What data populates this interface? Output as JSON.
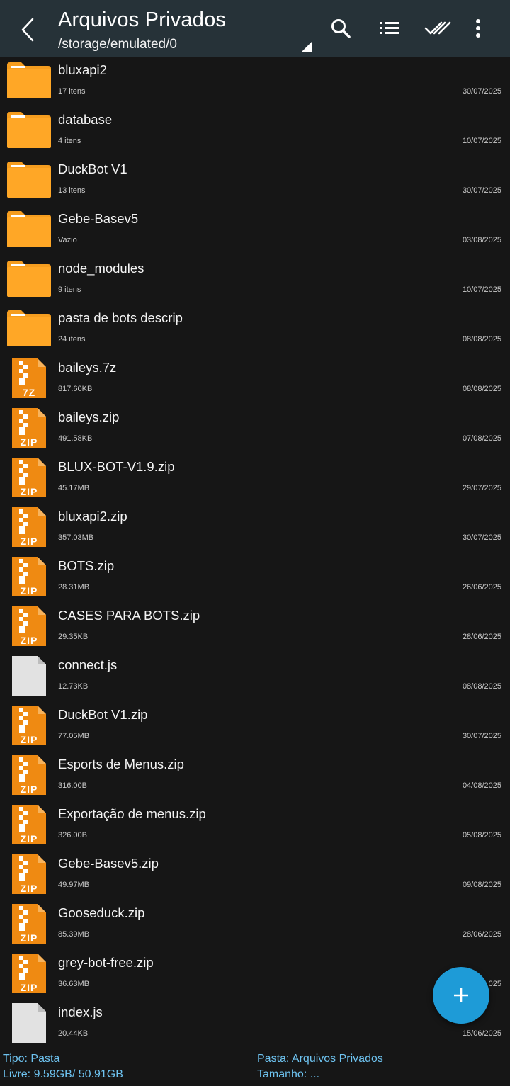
{
  "header": {
    "title": "Arquivos Privados",
    "path": "/storage/emulated/0"
  },
  "files": [
    {
      "name": "bluxapi2",
      "info": "17 itens",
      "date": "30/07/2025",
      "kind": "folder"
    },
    {
      "name": "database",
      "info": "4 itens",
      "date": "10/07/2025",
      "kind": "folder"
    },
    {
      "name": "DuckBot V1",
      "info": "13 itens",
      "date": "30/07/2025",
      "kind": "folder"
    },
    {
      "name": "Gebe-Basev5",
      "info": "Vazio",
      "date": "03/08/2025",
      "kind": "folder"
    },
    {
      "name": "node_modules",
      "info": "9 itens",
      "date": "10/07/2025",
      "kind": "folder"
    },
    {
      "name": "pasta de bots descrip",
      "info": "24 itens",
      "date": "08/08/2025",
      "kind": "folder"
    },
    {
      "name": "baileys.7z",
      "info": "817.60KB",
      "date": "08/08/2025",
      "kind": "archive",
      "label": "7Z"
    },
    {
      "name": "baileys.zip",
      "info": "491.58KB",
      "date": "07/08/2025",
      "kind": "archive",
      "label": "ZIP"
    },
    {
      "name": "BLUX-BOT-V1.9.zip",
      "info": "45.17MB",
      "date": "29/07/2025",
      "kind": "archive",
      "label": "ZIP"
    },
    {
      "name": "bluxapi2.zip",
      "info": "357.03MB",
      "date": "30/07/2025",
      "kind": "archive",
      "label": "ZIP"
    },
    {
      "name": "BOTS.zip",
      "info": "28.31MB",
      "date": "26/06/2025",
      "kind": "archive",
      "label": "ZIP"
    },
    {
      "name": "CASES PARA BOTS.zip",
      "info": "29.35KB",
      "date": "28/06/2025",
      "kind": "archive",
      "label": "ZIP"
    },
    {
      "name": "connect.js",
      "info": "12.73KB",
      "date": "08/08/2025",
      "kind": "document"
    },
    {
      "name": "DuckBot V1.zip",
      "info": "77.05MB",
      "date": "30/07/2025",
      "kind": "archive",
      "label": "ZIP"
    },
    {
      "name": "Esports de Menus.zip",
      "info": "316.00B",
      "date": "04/08/2025",
      "kind": "archive",
      "label": "ZIP"
    },
    {
      "name": "Exportação de menus.zip",
      "info": "326.00B",
      "date": "05/08/2025",
      "kind": "archive",
      "label": "ZIP"
    },
    {
      "name": "Gebe-Basev5.zip",
      "info": "49.97MB",
      "date": "09/08/2025",
      "kind": "archive",
      "label": "ZIP"
    },
    {
      "name": "Gooseduck.zip",
      "info": "85.39MB",
      "date": "28/06/2025",
      "kind": "archive",
      "label": "ZIP"
    },
    {
      "name": "grey-bot-free.zip",
      "info": "36.63MB",
      "date": "025",
      "kind": "archive",
      "label": "ZIP"
    },
    {
      "name": "index.js",
      "info": "20.44KB",
      "date": "15/06/2025",
      "kind": "document"
    }
  ],
  "footer": {
    "tipo": "Tipo: Pasta",
    "livre": "Livre: 9.59GB/ 50.91GB",
    "pasta": "Pasta: Arquivos Privados",
    "tamanho": "Tamanho: ..."
  },
  "colors": {
    "header_bg": "#263238",
    "folder": "#ffa726",
    "archive": "#ef8a12",
    "accent": "#1e9bd7",
    "footer_text": "#6ec3f0"
  },
  "icons": {
    "back": "chevron-left-icon",
    "search": "search-icon",
    "view": "list-view-icon",
    "select": "double-check-icon",
    "more": "more-vert-icon",
    "fab": "plus-icon"
  }
}
